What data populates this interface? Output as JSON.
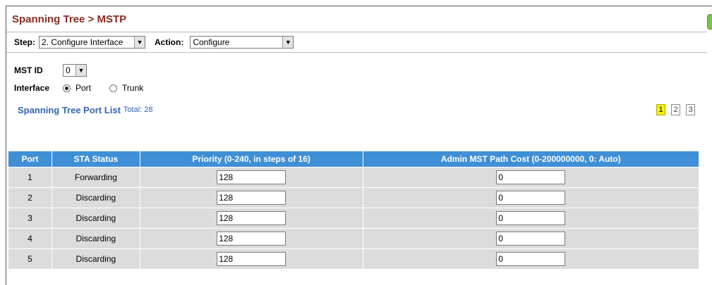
{
  "header": {
    "title": "Spanning Tree > MSTP"
  },
  "step_row": {
    "step_label": "Step:",
    "step_value": "2. Configure Interface",
    "action_label": "Action:",
    "action_value": "Configure"
  },
  "mst": {
    "label": "MST ID",
    "value": "0"
  },
  "interface": {
    "label": "Interface",
    "options": [
      {
        "label": "Port",
        "checked": true
      },
      {
        "label": "Trunk",
        "checked": false
      }
    ]
  },
  "list": {
    "title": "Spanning Tree Port List",
    "total": "Total: 28",
    "pages": [
      "1",
      "2",
      "3"
    ],
    "active_page": "1"
  },
  "table": {
    "columns": [
      "Port",
      "STA Status",
      "Priority (0-240, in steps of 16)",
      "Admin MST Path Cost (0-200000000, 0: Auto)"
    ],
    "rows": [
      {
        "port": "1",
        "status": "Forwarding",
        "priority": "128",
        "cost": "0"
      },
      {
        "port": "2",
        "status": "Discarding",
        "priority": "128",
        "cost": "0"
      },
      {
        "port": "3",
        "status": "Discarding",
        "priority": "128",
        "cost": "0"
      },
      {
        "port": "4",
        "status": "Discarding",
        "priority": "128",
        "cost": "0"
      },
      {
        "port": "5",
        "status": "Discarding",
        "priority": "128",
        "cost": "0"
      }
    ]
  },
  "colors": {
    "title": "#8a2c22",
    "table_header": "#3f8fd6",
    "row_bg": "#dcdcdc",
    "link_blue": "#3166b0",
    "active_page": "#f7f200"
  }
}
